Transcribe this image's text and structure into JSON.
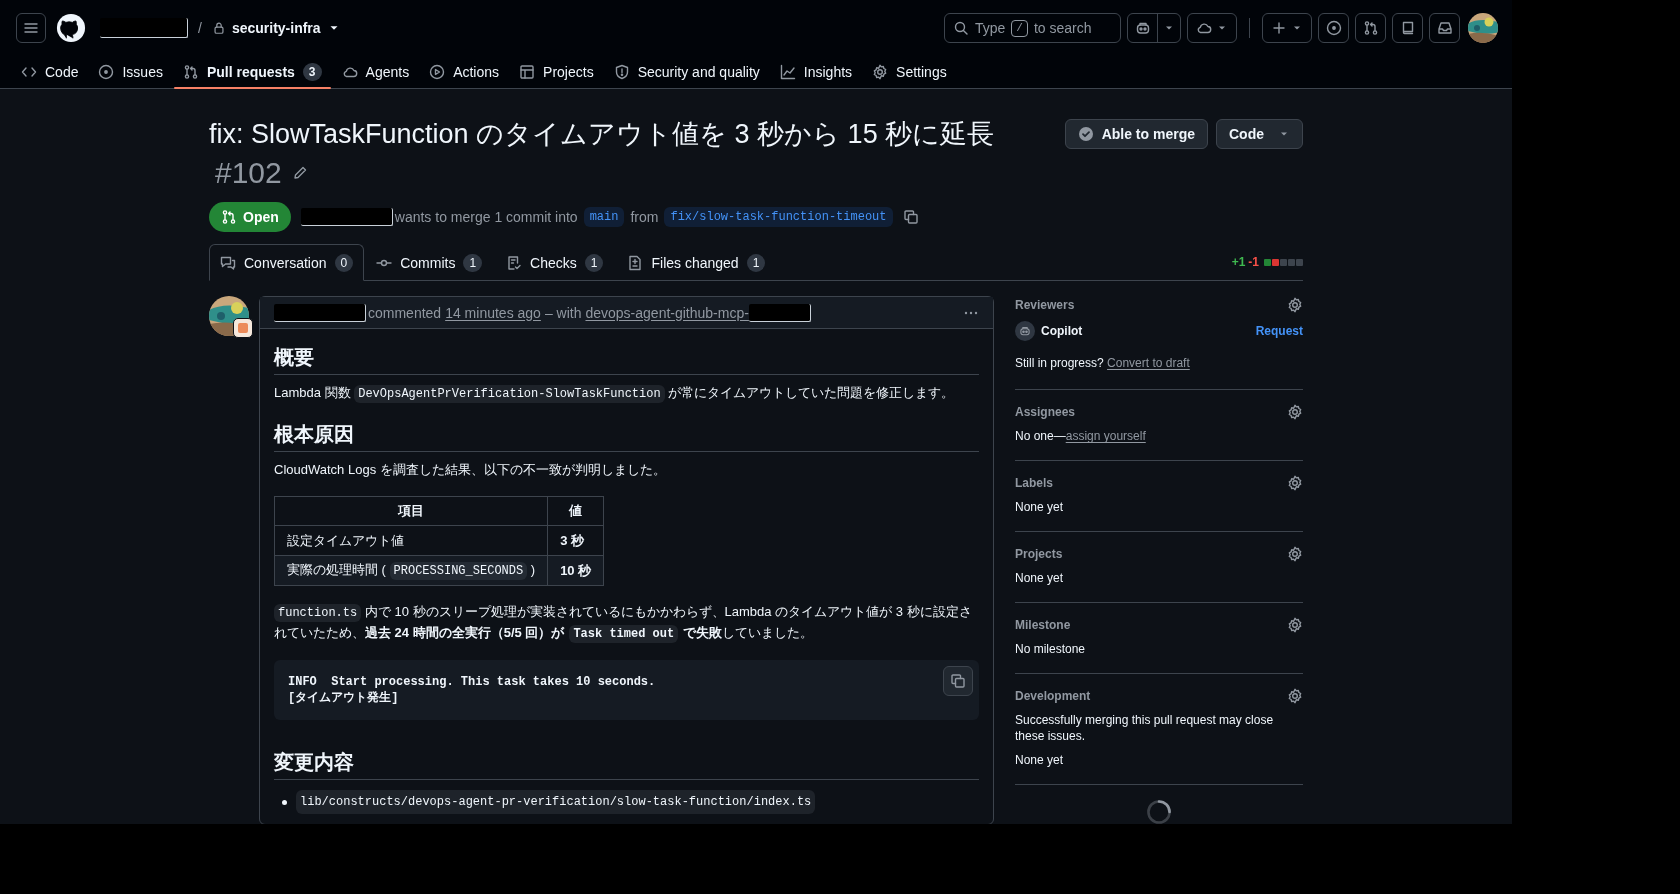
{
  "header": {
    "separator": "/",
    "repo": "security-infra",
    "search": {
      "hint": "Type",
      "key": "/",
      "hint_end": "to search"
    }
  },
  "nav": [
    {
      "label": "Code",
      "selected": false
    },
    {
      "label": "Issues",
      "selected": false
    },
    {
      "label": "Pull requests",
      "count": "3",
      "selected": true
    },
    {
      "label": "Agents",
      "selected": false
    },
    {
      "label": "Actions",
      "selected": false
    },
    {
      "label": "Projects",
      "selected": false
    },
    {
      "label": "Security and quality",
      "selected": false
    },
    {
      "label": "Insights",
      "selected": false
    },
    {
      "label": "Settings",
      "selected": false
    }
  ],
  "pr": {
    "title": "fix: SlowTaskFunction のタイムアウト値を 3 秒から 15 秒に延長",
    "number": "#102",
    "state": "Open",
    "merge_text": "wants to merge 1 commit into",
    "base": "main",
    "from": "from",
    "head": "fix/slow-task-function-timeout",
    "merge_status": "Able to merge",
    "code_button": "Code"
  },
  "tabs": [
    {
      "label": "Conversation",
      "count": "0",
      "selected": true
    },
    {
      "label": "Commits",
      "count": "1",
      "selected": false
    },
    {
      "label": "Checks",
      "count": "1",
      "selected": false
    },
    {
      "label": "Files changed",
      "count": "1",
      "selected": false
    }
  ],
  "diffstat": {
    "added": "+1",
    "removed": "-1",
    "blocks": [
      {
        "kind": "added"
      },
      {
        "kind": "removed"
      },
      {
        "kind": "neutral"
      },
      {
        "kind": "neutral"
      },
      {
        "kind": "neutral"
      }
    ]
  },
  "comment": {
    "action": "commented",
    "time": "14 minutes ago",
    "with": "– with",
    "app": "devops-agent-github-mcp-",
    "body": [
      {
        "kind": "heading",
        "text": "概要"
      },
      {
        "kind": "paragraph",
        "segments": [
          {
            "kind": "text",
            "text": "Lambda 関数 "
          },
          {
            "kind": "code",
            "text": "DevOpsAgentPrVerification-SlowTaskFunction"
          },
          {
            "kind": "text",
            "text": " が常にタイムアウトしていた問題を修正します。"
          }
        ]
      },
      {
        "kind": "heading",
        "text": "根本原因"
      },
      {
        "kind": "paragraph",
        "segments": [
          {
            "kind": "text",
            "text": "CloudWatch Logs を調査した結果、以下の不一致が判明しました。"
          }
        ]
      },
      {
        "kind": "table",
        "columns": [
          "項目",
          "値"
        ],
        "rows": [
          [
            [
              {
                "kind": "text",
                "text": "設定タイムアウト値"
              }
            ],
            [
              {
                "kind": "bold",
                "text": "3 秒"
              }
            ]
          ],
          [
            [
              {
                "kind": "text",
                "text": "実際の処理時間 ( "
              },
              {
                "kind": "code",
                "text": "PROCESSING_SECONDS"
              },
              {
                "kind": "text",
                "text": " )"
              }
            ],
            [
              {
                "kind": "bold",
                "text": "10 秒"
              }
            ]
          ]
        ]
      },
      {
        "kind": "paragraph",
        "segments": [
          {
            "kind": "code",
            "text": "function.ts"
          },
          {
            "kind": "text",
            "text": " 内で 10 秒のスリープ処理が実装されているにもかかわらず、Lambda のタイムアウト値が 3 秒に設定されていたため、"
          },
          {
            "kind": "bold",
            "text": "過去 24 時間の全実行（5/5 回）が"
          },
          {
            "kind": "bold_code",
            "text": "Task timed out"
          },
          {
            "kind": "bold",
            "text": "で失敗"
          },
          {
            "kind": "text",
            "text": "していました。"
          }
        ]
      },
      {
        "kind": "code_block",
        "lines": [
          "INFO  Start processing. This task takes 10 seconds.",
          "[タイムアウト発生]"
        ]
      },
      {
        "kind": "heading",
        "text": "変更内容"
      },
      {
        "kind": "list",
        "items": [
          [
            {
              "kind": "code",
              "text": "lib/constructs/devops-agent-pr-verification/slow-task-function/index.ts"
            }
          ]
        ]
      }
    ]
  },
  "sidebar": [
    {
      "kind": "reviewers",
      "title": "Reviewers",
      "reviewers": [
        {
          "name": "Copilot",
          "action": "Request"
        }
      ],
      "note": "Still in progress?",
      "link": "Convert to draft"
    },
    {
      "kind": "assignees",
      "title": "Assignees",
      "text": "No one—",
      "link": "assign yourself"
    },
    {
      "kind": "text",
      "title": "Labels",
      "lines": [
        "None yet"
      ]
    },
    {
      "kind": "text",
      "title": "Projects",
      "lines": [
        "None yet"
      ]
    },
    {
      "kind": "text",
      "title": "Milestone",
      "lines": [
        "No milestone"
      ]
    },
    {
      "kind": "text",
      "title": "Development",
      "lines": [
        "Successfully merging this pull request may close these issues.",
        "None yet"
      ]
    }
  ]
}
